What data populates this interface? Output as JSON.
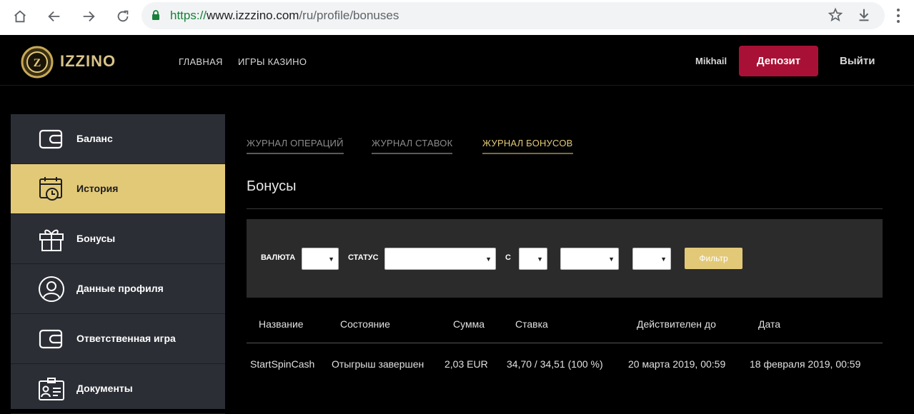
{
  "browser": {
    "url_scheme": "https://",
    "url_host": "www.izzzino.com",
    "url_path": "/ru/profile/bonuses",
    "icons": [
      "home-icon",
      "back-icon",
      "forward-icon",
      "reload-icon",
      "lock-icon",
      "star-icon",
      "download-icon",
      "menu-icon"
    ]
  },
  "header": {
    "logo_text": "IZZINO",
    "nav": [
      "ГЛАВНАЯ",
      "ИГРЫ КАЗИНО"
    ],
    "user_name": "Mikhail",
    "deposit_label": "Депозит",
    "logout_label": "Выйти",
    "deposit_color": "#a81135",
    "accent_color": "#e2c978"
  },
  "sidebar": {
    "items": [
      {
        "label": "Баланс",
        "icon": "wallet-icon",
        "active": false
      },
      {
        "label": "История",
        "icon": "calendar-clock-icon",
        "active": true
      },
      {
        "label": "Бонусы",
        "icon": "gift-icon",
        "active": false
      },
      {
        "label": "Данные профиля",
        "icon": "user-icon",
        "active": false
      },
      {
        "label": "Ответственная игра",
        "icon": "wallet-icon",
        "active": false
      },
      {
        "label": "Документы",
        "icon": "id-card-icon",
        "active": false
      }
    ]
  },
  "tabs": [
    {
      "label": "ЖУРНАЛ ОПЕРАЦИЙ",
      "active": false
    },
    {
      "label": "ЖУРНАЛ СТАВОК",
      "active": false
    },
    {
      "label": "ЖУРНАЛ БОНУСОВ",
      "active": true
    }
  ],
  "page_title": "Бонусы",
  "filter": {
    "currency_label": "ВАЛЮТА",
    "status_label": "СТАТУС",
    "from_label": "С",
    "button_label": "Фильтр"
  },
  "table": {
    "headers": [
      "Название",
      "Состояние",
      "Сумма",
      "Ставка",
      "Действителен до",
      "Дата"
    ],
    "rows": [
      [
        "StartSpinCash",
        "Отыгрыш завершен",
        "2,03 EUR",
        "34,70 / 34,51 (100 %)",
        "20 марта 2019, 00:59",
        "18 февраля 2019, 00:59"
      ]
    ]
  }
}
